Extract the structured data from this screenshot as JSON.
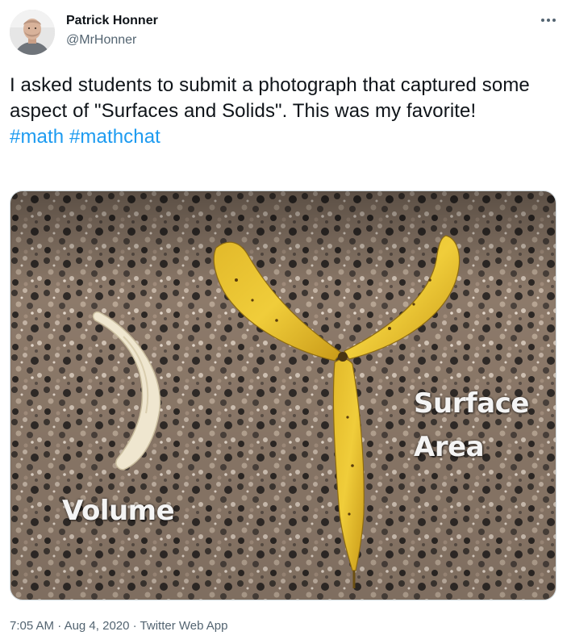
{
  "author": {
    "name": "Patrick Honner",
    "handle": "@MrHonner"
  },
  "tweet": {
    "text_line": "I asked students to submit a photograph that captured some aspect of \"Surfaces and Solids\". This was my favorite!",
    "hashtags": [
      "#math",
      "#mathchat"
    ]
  },
  "photo": {
    "label_volume": "Volume",
    "label_surface_line1": "Surface",
    "label_surface_line2": "Area"
  },
  "meta": {
    "time": "7:05 AM",
    "separator1": " · ",
    "date": "Aug 4, 2020",
    "separator2": " · ",
    "source": "Twitter Web App"
  },
  "colors": {
    "link": "#1d9bf0",
    "secondary_text": "#536471",
    "primary_text": "#0f1419"
  },
  "icons": {
    "more": "more-horizontal-icon",
    "avatar": "avatar"
  }
}
